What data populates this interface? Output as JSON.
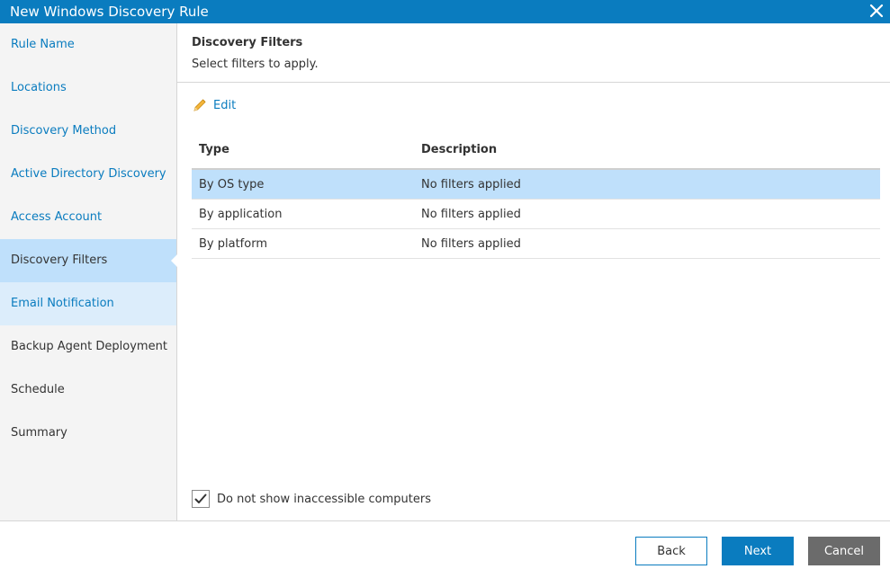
{
  "window": {
    "title": "New Windows Discovery Rule",
    "close_icon": "close-icon"
  },
  "sidebar": {
    "items": [
      {
        "label": "Rule Name",
        "state": "link"
      },
      {
        "label": "Locations",
        "state": "link"
      },
      {
        "label": "Discovery Method",
        "state": "link"
      },
      {
        "label": "Active Directory Discovery",
        "state": "link"
      },
      {
        "label": "Access Account",
        "state": "link"
      },
      {
        "label": "Discovery Filters",
        "state": "active"
      },
      {
        "label": "Email Notification",
        "state": "hover"
      },
      {
        "label": "Backup Agent Deployment",
        "state": "disabled"
      },
      {
        "label": "Schedule",
        "state": "disabled"
      },
      {
        "label": "Summary",
        "state": "disabled"
      }
    ]
  },
  "main": {
    "title": "Discovery Filters",
    "subtitle": "Select filters to apply.",
    "edit_label": "Edit",
    "edit_icon": "pencil-icon",
    "table": {
      "columns": [
        "Type",
        "Description"
      ],
      "rows": [
        {
          "type": "By OS type",
          "description": "No filters applied",
          "selected": true
        },
        {
          "type": "By application",
          "description": "No filters applied",
          "selected": false
        },
        {
          "type": "By platform",
          "description": "No filters applied",
          "selected": false
        }
      ]
    },
    "checkbox": {
      "label": "Do not show inaccessible computers",
      "checked": true
    }
  },
  "footer": {
    "back_label": "Back",
    "next_label": "Next",
    "cancel_label": "Cancel"
  },
  "colors": {
    "accent": "#0a7cbf",
    "selected_row": "#bfe0fb",
    "hover_item": "#dcedfb",
    "cancel_button": "#6b6b6b"
  }
}
